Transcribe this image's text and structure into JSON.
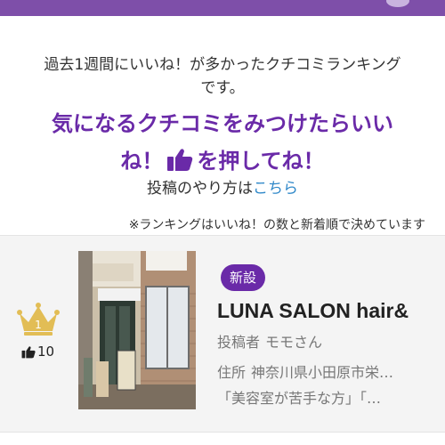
{
  "intro": {
    "line1": "過去1週間にいいね！が多かったクチコミランキング",
    "line2": "です。"
  },
  "headline": {
    "line1": "気になるクチコミをみつけたらいい",
    "line2_pre": "ね！",
    "line2_post": "を押してね！"
  },
  "howto": {
    "text": "投稿のやり方は",
    "link": "こちら"
  },
  "note": "※ランキングはいいね！の数と新着順で決めています",
  "ranking": [
    {
      "rank": "1",
      "likes": "10",
      "badge": "新設",
      "salon_name": "LUNA SALON hair&",
      "poster_label": "投稿者",
      "poster_name": "モモさん",
      "address_label": "住所",
      "address": "神奈川県小田原市栄…",
      "excerpt": "「美容室が苦手な方」「…"
    }
  ],
  "colors": {
    "brand": "#7e4fa9",
    "headline": "#6a2aa8",
    "link": "#2f88c9",
    "crown": "#e2bd55"
  },
  "icons": [
    "thumbs-up-icon",
    "crown-icon"
  ]
}
